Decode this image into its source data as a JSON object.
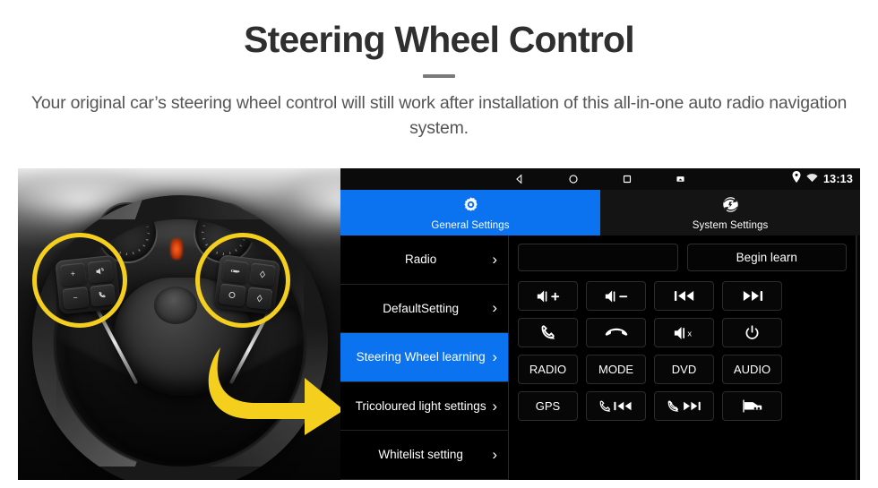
{
  "header": {
    "title": "Steering Wheel Control",
    "subtitle": "Your original car’s steering wheel control will still work after installation of this all-in-one auto radio navigation system."
  },
  "colors": {
    "accent_blue": "#0b72f0",
    "highlight_yellow": "#f5cf1e",
    "panel_black": "#000000",
    "title_gray": "#2f2f2f"
  },
  "photo": {
    "alt": "steering-wheel-with-highlighted-control-buttons",
    "left_pad_keys": [
      "volume-up",
      "volume-down",
      "voice-command",
      "phone-call"
    ],
    "right_pad_keys": [
      "cruise-set",
      "mode-up",
      "cruise-resume",
      "mode-down"
    ]
  },
  "unit": {
    "navbar": {
      "back": "back-icon",
      "home": "home-icon",
      "recents": "recents-icon",
      "screenshot": "screenshot-icon"
    },
    "statusbar": {
      "location": "location-pin-icon",
      "wifi": "wifi-icon",
      "clock": "13:13"
    },
    "tabs": [
      {
        "label": "General Settings",
        "icon": "gear-icon",
        "active": true
      },
      {
        "label": "System Settings",
        "icon": "system-settings-icon",
        "active": false
      }
    ],
    "sidebar": [
      {
        "label": "Radio",
        "selected": false
      },
      {
        "label": "DefaultSetting",
        "selected": false
      },
      {
        "label": "Steering Wheel learning",
        "selected": true
      },
      {
        "label": "Tricoloured light settings",
        "selected": false
      },
      {
        "label": "Whitelist setting",
        "selected": false
      }
    ],
    "learn_field_value": "",
    "begin_learn_label": "Begin learn",
    "function_buttons": [
      {
        "name": "volume-up-button",
        "label": "",
        "icon": "speaker-plus"
      },
      {
        "name": "volume-down-button",
        "label": "",
        "icon": "speaker-minus"
      },
      {
        "name": "previous-track-button",
        "label": "",
        "icon": "previous"
      },
      {
        "name": "next-track-button",
        "label": "",
        "icon": "next"
      },
      {
        "name": "answer-call-button",
        "label": "",
        "icon": "phone"
      },
      {
        "name": "hang-up-button",
        "label": "",
        "icon": "phone-down"
      },
      {
        "name": "mute-button",
        "label": "",
        "icon": "speaker-x"
      },
      {
        "name": "power-button",
        "label": "",
        "icon": "power"
      },
      {
        "name": "radio-button",
        "label": "RADIO",
        "icon": ""
      },
      {
        "name": "mode-button",
        "label": "MODE",
        "icon": ""
      },
      {
        "name": "dvd-button",
        "label": "DVD",
        "icon": ""
      },
      {
        "name": "audio-button",
        "label": "AUDIO",
        "icon": ""
      },
      {
        "name": "gps-button",
        "label": "GPS",
        "icon": ""
      },
      {
        "name": "call-previous-button",
        "label": "",
        "icon": "phone-previous"
      },
      {
        "name": "call-next-button",
        "label": "",
        "icon": "phonedown-next"
      },
      {
        "name": "camera-button",
        "label": "",
        "icon": "car-camera"
      }
    ]
  }
}
